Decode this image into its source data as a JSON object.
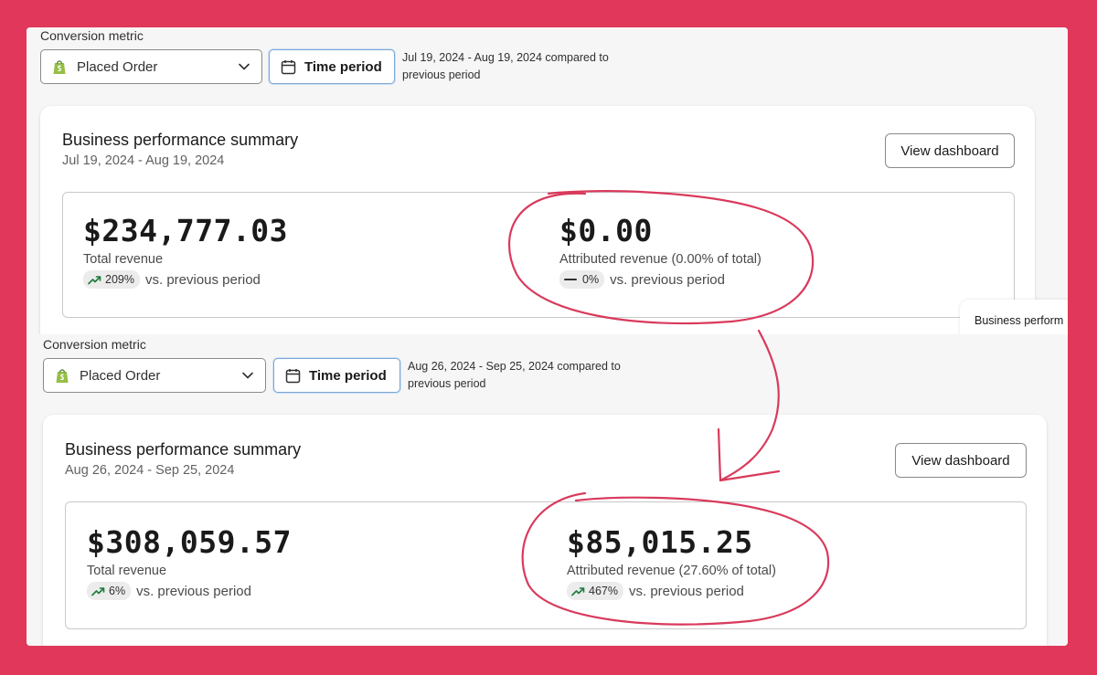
{
  "screens": [
    {
      "conversion_metric_label": "Conversion metric",
      "select_value": "Placed Order",
      "time_period_label": "Time period",
      "period_line1": "Jul 19, 2024 - Aug 19, 2024 compared to",
      "period_line2": "previous period",
      "card_title": "Business performance summary",
      "card_date": "Jul 19, 2024 - Aug 19, 2024",
      "view_dashboard_label": "View dashboard",
      "total_revenue": {
        "value": "$234,777.03",
        "label": "Total revenue",
        "change": "209%",
        "trend": "up",
        "vs_label": "vs. previous period"
      },
      "attributed_revenue": {
        "value": "$0.00",
        "label": "Attributed revenue (0.00% of total)",
        "change": "0%",
        "trend": "flat",
        "vs_label": "vs. previous period"
      }
    },
    {
      "conversion_metric_label": "Conversion metric",
      "select_value": "Placed Order",
      "time_period_label": "Time period",
      "period_line1": "Aug 26, 2024 - Sep 25, 2024 compared to",
      "period_line2": "previous period",
      "card_title": "Business performance summary",
      "card_date": "Aug 26, 2024 - Sep 25, 2024",
      "view_dashboard_label": "View dashboard",
      "total_revenue": {
        "value": "$308,059.57",
        "label": "Total revenue",
        "change": "6%",
        "trend": "up",
        "vs_label": "vs. previous period"
      },
      "attributed_revenue": {
        "value": "$85,015.25",
        "label": "Attributed revenue (27.60% of total)",
        "change": "467%",
        "trend": "up",
        "vs_label": "vs. previous period"
      }
    }
  ],
  "ghost_card_title": "Business perform",
  "colors": {
    "border_background": "#e0375a",
    "annotation_stroke": "#d93a5c",
    "trend_up_icon": "#1a7a3a",
    "badge_background": "#ececec"
  },
  "icons": [
    "shopify-bag-icon",
    "chevron-down-icon",
    "calendar-icon",
    "trend-up-icon",
    "trend-flat-icon"
  ]
}
